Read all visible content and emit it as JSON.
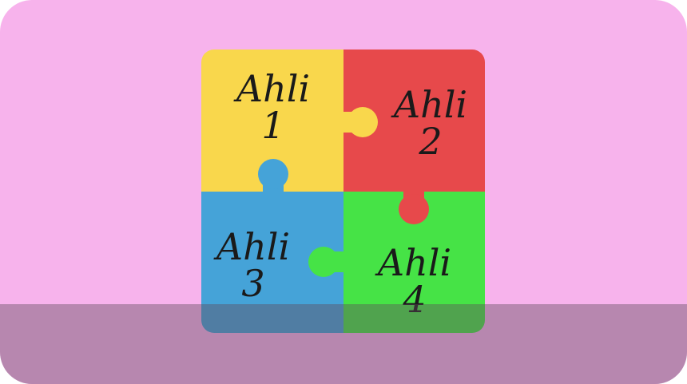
{
  "colors": {
    "background": "#f7b3ec",
    "overlay": "#5f4b5a",
    "piece_1": "#f9d74c",
    "piece_2": "#e7494b",
    "piece_3": "#45a3d8",
    "piece_4": "#46e346"
  },
  "pieces": [
    {
      "word": "Ahli",
      "number": "1"
    },
    {
      "word": "Ahli",
      "number": "2"
    },
    {
      "word": "Ahli",
      "number": "3"
    },
    {
      "word": "Ahli",
      "number": "4"
    }
  ]
}
